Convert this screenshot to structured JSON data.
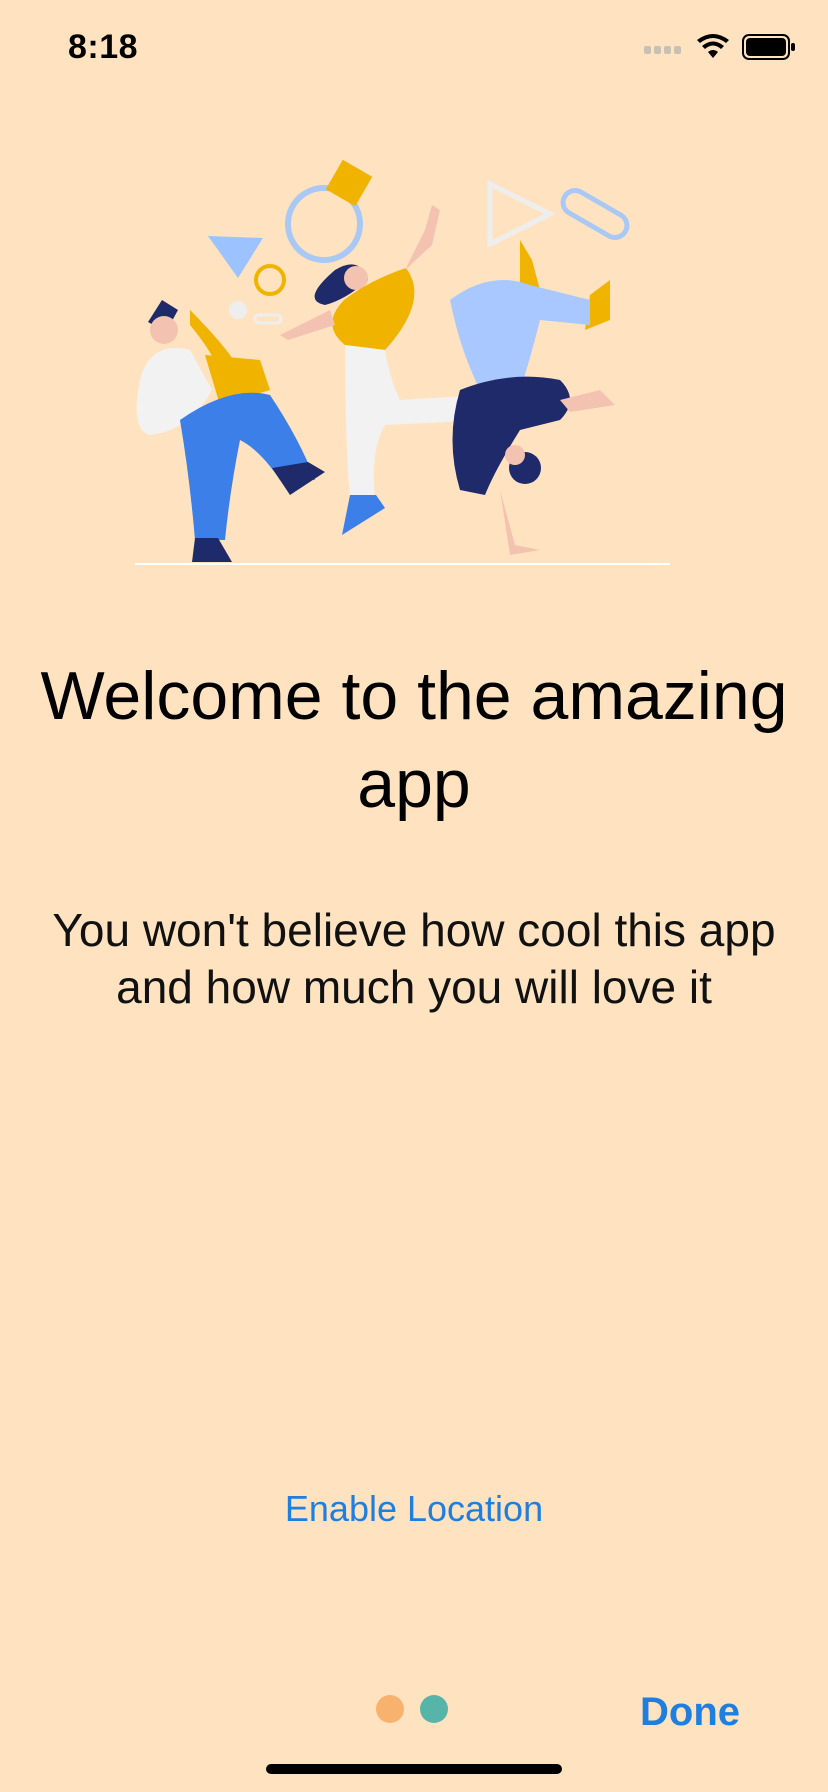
{
  "status_bar": {
    "time": "8:18"
  },
  "onboarding": {
    "title": "Welcome to the amazing app",
    "subtitle": "You won't believe how cool this app and how much you will love it",
    "enable_location_label": "Enable Location",
    "done_label": "Done"
  },
  "page_indicator": {
    "page_count": 2,
    "current_page": 2,
    "dots": [
      {
        "color": "#F9B26E"
      },
      {
        "color": "#56B5A8"
      }
    ]
  },
  "colors": {
    "background": "#FFE3C0",
    "accent": "#1E7FE0"
  },
  "icons": {
    "signal": "cellular-signal-icon",
    "wifi": "wifi-icon",
    "battery": "battery-icon",
    "illustration": "dancing-people-illustration"
  }
}
